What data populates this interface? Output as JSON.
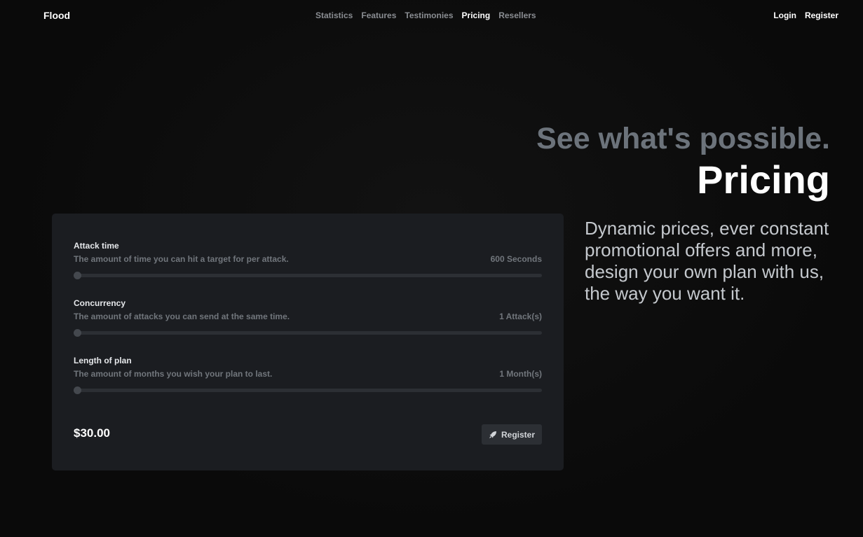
{
  "brand": "Flood",
  "nav": {
    "links": [
      "Statistics",
      "Features",
      "Testimonies",
      "Pricing",
      "Resellers"
    ],
    "active": "Pricing"
  },
  "auth": {
    "login": "Login",
    "register": "Register"
  },
  "headline": {
    "sub": "See what's possible.",
    "title": "Pricing"
  },
  "description": "Dynamic prices, ever constant promotional offers and more, design your own plan with us, the way you want it.",
  "calculator": {
    "options": [
      {
        "label": "Attack time",
        "hint": "The amount of time you can hit a target for per attack.",
        "value": "600 Seconds",
        "level": 0
      },
      {
        "label": "Concurrency",
        "hint": "The amount of attacks you can send at the same time.",
        "value": "1 Attack(s)",
        "level": 0
      },
      {
        "label": "Length of plan",
        "hint": "The amount of months you wish your plan to last.",
        "value": "1 Month(s)",
        "level": 0
      }
    ],
    "price": "$30.00",
    "register_label": "Register",
    "register_icon": "rocket-icon"
  }
}
